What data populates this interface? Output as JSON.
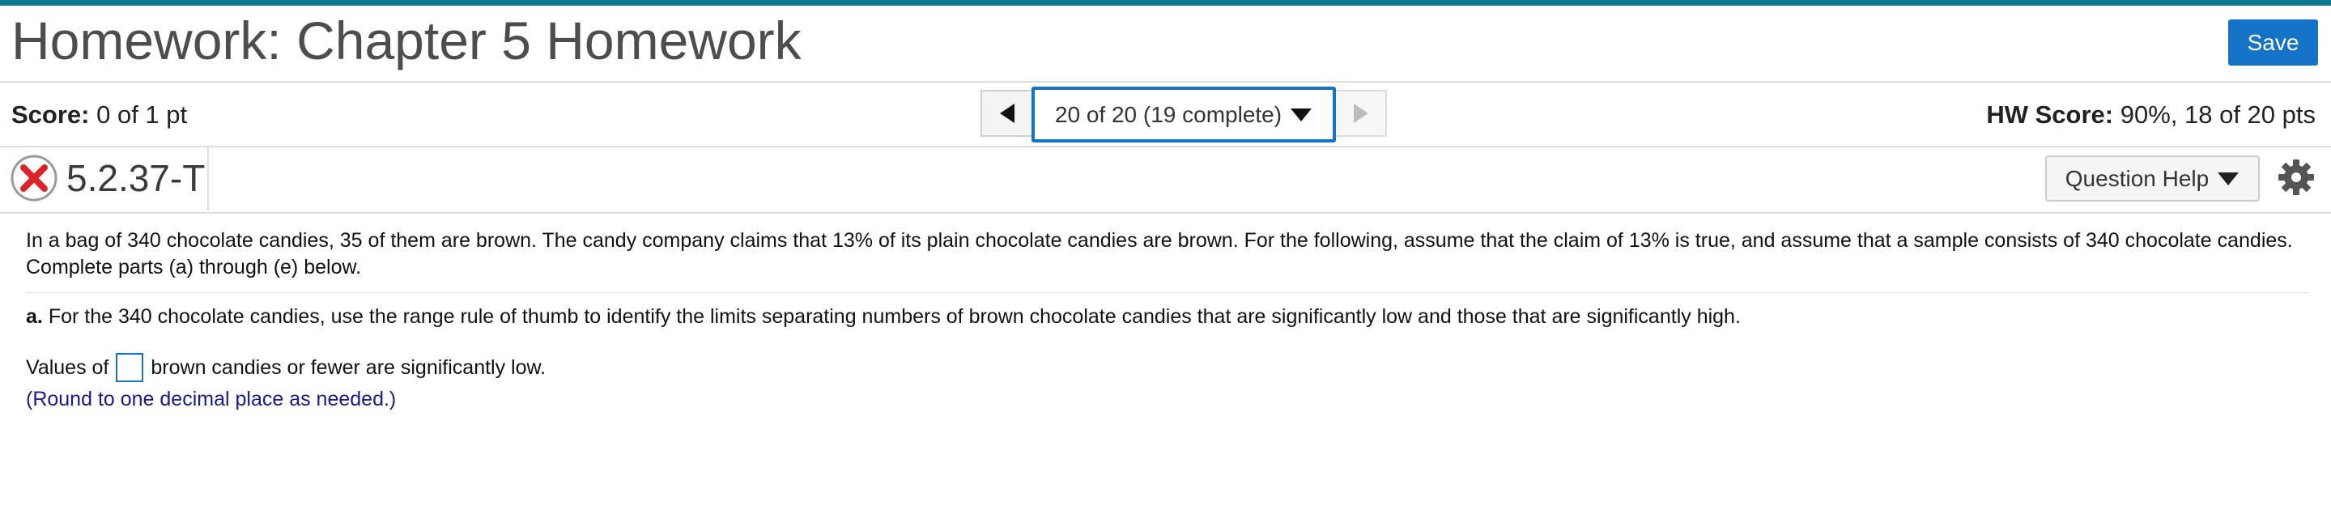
{
  "header": {
    "title": "Homework: Chapter 5 Homework",
    "save_label": "Save"
  },
  "score_bar": {
    "score_label": "Score:",
    "score_value": "0 of 1 pt",
    "hw_score_label": "HW Score:",
    "hw_score_value": "90%, 18 of 20 pts",
    "question_select": "20 of 20 (19 complete)"
  },
  "question": {
    "status": "incorrect",
    "id": "5.2.37-T",
    "help_label": "Question Help"
  },
  "content": {
    "intro": "In a bag of 340 chocolate candies, 35 of them are brown. The candy company claims that 13% of its plain chocolate candies are brown. For the following, assume that the claim of 13% is true, and assume that a sample consists of 340 chocolate candies. Complete parts (a) through (e) below.",
    "part_a_label": "a.",
    "part_a_text": "For the 340 chocolate candies, use the range rule of thumb to identify the limits separating numbers of brown chocolate candies that are significantly low and those that are significantly high.",
    "answer_prefix": "Values of",
    "answer_value": "",
    "answer_suffix": "brown candies or fewer are significantly low.",
    "hint": "(Round to one decimal place as needed.)"
  },
  "icons": {
    "status": "x-circle-icon",
    "prev": "caret-left-icon",
    "next": "caret-right-icon",
    "dropdown": "caret-down-icon",
    "settings": "gear-icon"
  },
  "colors": {
    "accent": "#1473c7",
    "top_bar": "#0b7a92",
    "incorrect": "#d9242b",
    "hint_text": "#1a1a8c"
  }
}
